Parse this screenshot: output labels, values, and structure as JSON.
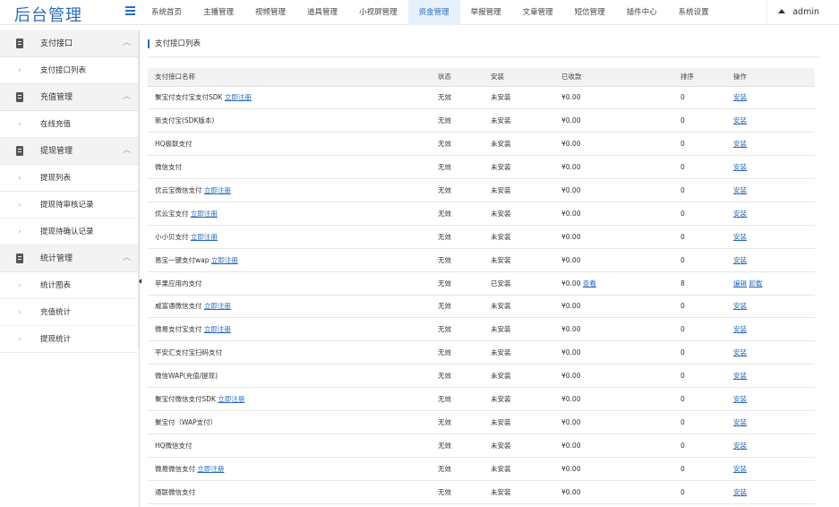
{
  "app": {
    "title": "后台管理"
  },
  "nav": {
    "items": [
      {
        "label": "系统首页",
        "active": false
      },
      {
        "label": "主播管理",
        "active": false
      },
      {
        "label": "视频管理",
        "active": false
      },
      {
        "label": "道具管理",
        "active": false
      },
      {
        "label": "小视屏管理",
        "active": false
      },
      {
        "label": "资金管理",
        "active": true
      },
      {
        "label": "举报管理",
        "active": false
      },
      {
        "label": "文章管理",
        "active": false
      },
      {
        "label": "短信管理",
        "active": false
      },
      {
        "label": "插件中心",
        "active": false
      },
      {
        "label": "系统设置",
        "active": false
      }
    ],
    "user": "admin"
  },
  "sidebar": {
    "entries": [
      {
        "type": "group",
        "label": "支付接口"
      },
      {
        "type": "item",
        "label": "支付接口列表"
      },
      {
        "type": "group",
        "label": "充值管理"
      },
      {
        "type": "item",
        "label": "在线充值"
      },
      {
        "type": "group",
        "label": "提现管理"
      },
      {
        "type": "item",
        "label": "提现列表"
      },
      {
        "type": "item",
        "label": "提现待审核记录"
      },
      {
        "type": "item",
        "label": "提现待确认记录"
      },
      {
        "type": "group",
        "label": "统计管理"
      },
      {
        "type": "item",
        "label": "统计图表"
      },
      {
        "type": "item",
        "label": "充值统计"
      },
      {
        "type": "item",
        "label": "提现统计"
      }
    ]
  },
  "page": {
    "title": "支付接口列表"
  },
  "table": {
    "headers": [
      "支付接口名称",
      "状态",
      "安装",
      "已收款",
      "排序",
      "操作"
    ],
    "rows": [
      {
        "name": "聚宝付支付宝支付SDK",
        "link": "立即注册",
        "status": "无效",
        "install": "未安装",
        "paid": "¥0.00",
        "view": "",
        "sort": "0",
        "ops": [
          "安装"
        ]
      },
      {
        "name": "新支付宝(SDK版本)",
        "link": "",
        "status": "无效",
        "install": "未安装",
        "paid": "¥0.00",
        "view": "",
        "sort": "0",
        "ops": [
          "安装"
        ]
      },
      {
        "name": "HQ极联支付",
        "link": "",
        "status": "无效",
        "install": "未安装",
        "paid": "¥0.00",
        "view": "",
        "sort": "0",
        "ops": [
          "安装"
        ]
      },
      {
        "name": "微信支付",
        "link": "",
        "status": "无效",
        "install": "未安装",
        "paid": "¥0.00",
        "view": "",
        "sort": "0",
        "ops": [
          "安装"
        ]
      },
      {
        "name": "优云宝微信支付",
        "link": "立即注册",
        "status": "无效",
        "install": "未安装",
        "paid": "¥0.00",
        "view": "",
        "sort": "0",
        "ops": [
          "安装"
        ]
      },
      {
        "name": "优云宝支付",
        "link": "立即注册",
        "status": "无效",
        "install": "未安装",
        "paid": "¥0.00",
        "view": "",
        "sort": "0",
        "ops": [
          "安装"
        ]
      },
      {
        "name": "小小贝支付",
        "link": "立即注册",
        "status": "无效",
        "install": "未安装",
        "paid": "¥0.00",
        "view": "",
        "sort": "0",
        "ops": [
          "安装"
        ]
      },
      {
        "name": "易宝一键支付wap",
        "link": "立即注册",
        "status": "无效",
        "install": "未安装",
        "paid": "¥0.00",
        "view": "",
        "sort": "0",
        "ops": [
          "安装"
        ]
      },
      {
        "name": "苹果应用内支付",
        "link": "",
        "status": "无效",
        "install": "已安装",
        "paid": "¥0.00",
        "view": "查看",
        "sort": "8",
        "ops": [
          "编辑",
          "卸载"
        ]
      },
      {
        "name": "威富通微信支付",
        "link": "立即注册",
        "status": "无效",
        "install": "未安装",
        "paid": "¥0.00",
        "view": "",
        "sort": "0",
        "ops": [
          "安装"
        ]
      },
      {
        "name": "微易支付宝支付",
        "link": "立即注册",
        "status": "无效",
        "install": "未安装",
        "paid": "¥0.00",
        "view": "",
        "sort": "0",
        "ops": [
          "安装"
        ]
      },
      {
        "name": "平安汇支付宝扫码支付",
        "link": "",
        "status": "无效",
        "install": "未安装",
        "paid": "¥0.00",
        "view": "",
        "sort": "0",
        "ops": [
          "安装"
        ]
      },
      {
        "name": "微信WAP(充值/提现)",
        "link": "",
        "status": "无效",
        "install": "未安装",
        "paid": "¥0.00",
        "view": "",
        "sort": "0",
        "ops": [
          "安装"
        ]
      },
      {
        "name": "聚宝付微信支付SDK",
        "link": "立即注册",
        "status": "无效",
        "install": "未安装",
        "paid": "¥0.00",
        "view": "",
        "sort": "0",
        "ops": [
          "安装"
        ]
      },
      {
        "name": "聚宝付（WAP支付）",
        "link": "",
        "status": "无效",
        "install": "未安装",
        "paid": "¥0.00",
        "view": "",
        "sort": "0",
        "ops": [
          "安装"
        ]
      },
      {
        "name": "HQ微信支付",
        "link": "",
        "status": "无效",
        "install": "未安装",
        "paid": "¥0.00",
        "view": "",
        "sort": "0",
        "ops": [
          "安装"
        ]
      },
      {
        "name": "微易微信支付",
        "link": "立即注册",
        "status": "无效",
        "install": "未安装",
        "paid": "¥0.00",
        "view": "",
        "sort": "0",
        "ops": [
          "安装"
        ]
      },
      {
        "name": "通联微信支付",
        "link": "",
        "status": "无效",
        "install": "未安装",
        "paid": "¥0.00",
        "view": "",
        "sort": "0",
        "ops": [
          "安装"
        ]
      }
    ]
  }
}
